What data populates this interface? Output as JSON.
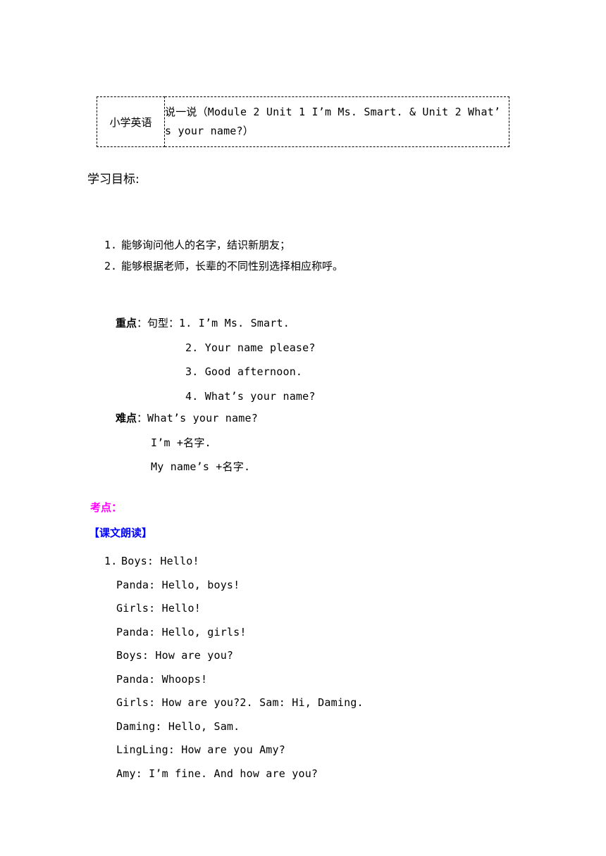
{
  "header": {
    "subject": "小学英语",
    "title_line1_prefix": "说一说（Module 2 Unit 1 I’m Ms. Smart. & Unit 2 What’",
    "title_line2": "s your name?）"
  },
  "sections": {
    "goals_title": "学习目标:",
    "goals": [
      {
        "num": "1.",
        "text": "能够询问他人的名字，结识新朋友；"
      },
      {
        "num": "2.",
        "text": "能够根据老师，长辈的不同性别选择相应称呼。"
      }
    ],
    "key_label": "重点",
    "key_colon": "：句型：",
    "key_items": [
      "1. I’m Ms. Smart.",
      "2. Your name please?",
      "3. Good afternoon.",
      "4. What’s your name?"
    ],
    "hard_label": "难点",
    "hard_colon": "：",
    "hard_first": "What’s your name?",
    "hard_items": [
      "I’m +名字.",
      "My name’s +名字."
    ],
    "exam_title": "考点：",
    "read_title": "【课文朗读】",
    "dialog": [
      {
        "num": "1.",
        "text": "Boys: Hello!"
      },
      {
        "num": "",
        "text": "Panda: Hello, boys!"
      },
      {
        "num": "",
        "text": "Girls: Hello!"
      },
      {
        "num": "",
        "text": "Panda: Hello, girls!"
      },
      {
        "num": "",
        "text": "Boys: How are you?"
      },
      {
        "num": "",
        "text": "Panda: Whoops!"
      },
      {
        "num": "",
        "text": "Girls: How are you?2. Sam: Hi, Daming."
      },
      {
        "num": "",
        "text": "Daming: Hello, Sam."
      },
      {
        "num": "",
        "text": "LingLing: How are you Amy?"
      },
      {
        "num": "",
        "text": "Amy: I’m fine. And how are you?"
      }
    ]
  },
  "colors": {
    "exam_accent": "#ff00ff",
    "read_accent": "#0000ff"
  }
}
